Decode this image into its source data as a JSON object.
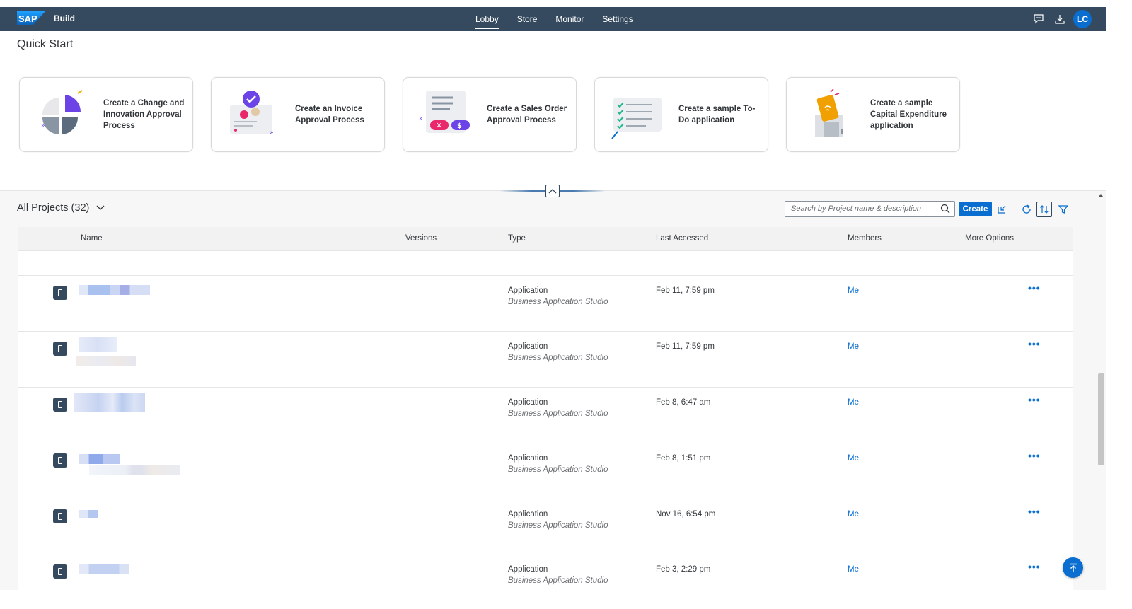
{
  "shellbar": {
    "brand": "Build",
    "nav": [
      "Lobby",
      "Store",
      "Monitor",
      "Settings"
    ],
    "active_nav": "Lobby",
    "avatar_initials": "LC",
    "logo_text": "SAP"
  },
  "quick_start": {
    "title": "Quick Start",
    "cards": [
      {
        "label": "Create a Change and Innovation Approval Process"
      },
      {
        "label": "Create an Invoice Approval Process"
      },
      {
        "label": "Create a Sales Order Approval Process"
      },
      {
        "label": "Create a sample To-Do application"
      },
      {
        "label": "Create a sample Capital Expenditure application"
      }
    ]
  },
  "projects": {
    "title": "All Projects (32)",
    "search_placeholder": "Search by Project name & description",
    "create_label": "Create",
    "columns": [
      "Name",
      "Versions",
      "Type",
      "Last Accessed",
      "Members",
      "More Options"
    ],
    "rows": [
      {
        "type": "Application",
        "sub": "Business Application Studio",
        "last": "Feb 11, 7:59 pm",
        "member": "Me",
        "more": "•••"
      },
      {
        "type": "Application",
        "sub": "Business Application Studio",
        "last": "Feb 11, 7:59 pm",
        "member": "Me",
        "more": "•••"
      },
      {
        "type": "Application",
        "sub": "Business Application Studio",
        "last": "Feb 8, 6:47 am",
        "member": "Me",
        "more": "•••"
      },
      {
        "type": "Application",
        "sub": "Business Application Studio",
        "last": "Feb 8, 1:51 pm",
        "member": "Me",
        "more": "•••"
      },
      {
        "type": "Application",
        "sub": "Business Application Studio",
        "last": "Nov 16, 6:54 pm",
        "member": "Me",
        "more": "•••"
      },
      {
        "type": "Application",
        "sub": "Business Application Studio",
        "last": "Feb 3, 2:29 pm",
        "member": "Me",
        "more": "•••"
      }
    ]
  },
  "colors": {
    "shell": "#354a5f",
    "accent": "#0a6ed1"
  }
}
